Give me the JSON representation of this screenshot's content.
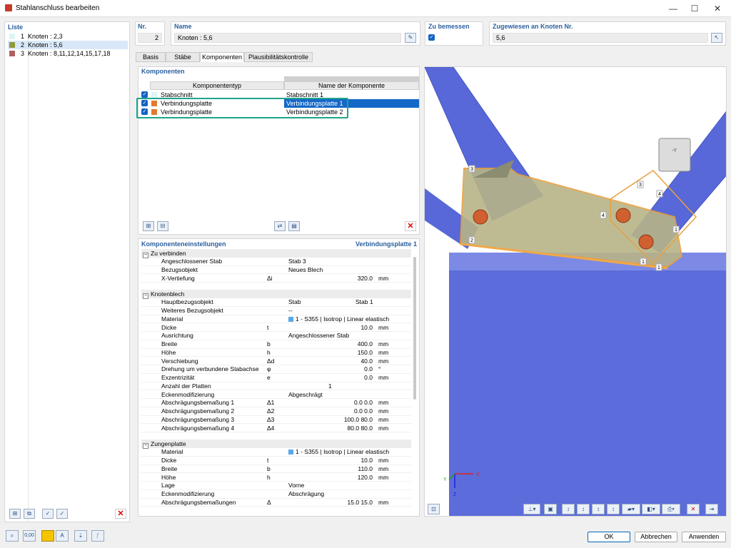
{
  "window": {
    "title": "Stahlanschluss bearbeiten",
    "minimize": "—",
    "maximize": "☐",
    "close": "✕"
  },
  "list": {
    "header": "Liste",
    "items": [
      {
        "num": "1",
        "label": "Knoten : 2,3",
        "color": "#dff4f6"
      },
      {
        "num": "2",
        "label": "Knoten : 5,6",
        "color": "#8f9a3a"
      },
      {
        "num": "3",
        "label": "Knoten : 8,11,12,14,15,17,18",
        "color": "#b06060"
      }
    ]
  },
  "header": {
    "nr_label": "Nr.",
    "nr_value": "2",
    "name_label": "Name",
    "name_value": "Knoten : 5,6",
    "zu_bemessen_label": "Zu bemessen",
    "zugewiesen_label": "Zugewiesen an Knoten Nr.",
    "zugewiesen_value": "5,6"
  },
  "tabs": [
    "Basis",
    "Stäbe",
    "Komponenten",
    "Plausibilitätskontrolle"
  ],
  "komponenten": {
    "title": "Komponenten",
    "col_type": "Komponententyp",
    "col_name": "Name der Komponente",
    "rows": [
      {
        "type": "Stabschnitt",
        "name": "Stabschnitt 1",
        "color": "#dff4f6"
      },
      {
        "type": "Verbindungsplatte",
        "name": "Verbindungsplatte 1",
        "color": "#e07a30"
      },
      {
        "type": "Verbindungsplatte",
        "name": "Verbindungsplatte 2",
        "color": "#e07a30"
      }
    ]
  },
  "settings": {
    "title": "Komponenteneinstellungen",
    "component": "Verbindungsplatte 1",
    "groups": [
      {
        "label": "Zu verbinden",
        "rows": [
          {
            "name": "Angeschlossener Stab",
            "sym": "",
            "val": "Stab 3",
            "num": "",
            "unit": ""
          },
          {
            "name": "Bezugsobjekt",
            "sym": "",
            "val": "Neues Blech",
            "num": "",
            "unit": ""
          },
          {
            "name": "X-Vertiefung",
            "sym": "Δi",
            "val": "",
            "num": "320.0",
            "unit": "mm"
          }
        ]
      },
      {
        "label": "Knotenblech",
        "rows": [
          {
            "name": "Hauptbezugsobjekt",
            "sym": "",
            "val": "Stab",
            "v2": "Stab 1",
            "num": "",
            "unit": ""
          },
          {
            "name": "Weiteres Bezugsobjekt",
            "sym": "",
            "val": "--",
            "num": "",
            "unit": ""
          },
          {
            "name": "Material",
            "sym": "",
            "val": "1 - S355 | Isotrop | Linear elastisch",
            "mat": true,
            "num": "",
            "unit": ""
          },
          {
            "name": "Dicke",
            "sym": "t",
            "val": "",
            "num": "10.0",
            "unit": "mm"
          },
          {
            "name": "Ausrichtung",
            "sym": "",
            "val": "Angeschlossener Stab",
            "num": "",
            "unit": ""
          },
          {
            "name": "Breite",
            "sym": "b",
            "val": "",
            "num": "400.0",
            "unit": "mm"
          },
          {
            "name": "Höhe",
            "sym": "h",
            "val": "",
            "num": "150.0",
            "unit": "mm"
          },
          {
            "name": "Verschiebung",
            "sym": "Δd",
            "val": "",
            "num": "40.0",
            "unit": "mm"
          },
          {
            "name": "Drehung um verbundene Stabachse",
            "sym": "φ",
            "val": "",
            "num": "0.0",
            "unit": "°"
          },
          {
            "name": "Exzentrizität",
            "sym": "e",
            "val": "",
            "num": "0.0",
            "unit": "mm"
          },
          {
            "name": "Anzahl der Platten",
            "sym": "",
            "val": "",
            "num": "1",
            "unit": "",
            "center": true
          },
          {
            "name": "Eckenmodifizierung",
            "sym": "",
            "val": "Abgeschrägt",
            "num": "",
            "unit": ""
          },
          {
            "name": "Abschrägungsbemaßung 1",
            "sym": "Δ1",
            "val": "",
            "num": "0.0 0.0",
            "unit": "mm"
          },
          {
            "name": "Abschrägungsbemaßung 2",
            "sym": "Δ2",
            "val": "",
            "num": "0.0 0.0",
            "unit": "mm"
          },
          {
            "name": "Abschrägungsbemaßung 3",
            "sym": "Δ3",
            "val": "",
            "num": "100.0 80.0",
            "unit": "mm"
          },
          {
            "name": "Abschrägungsbemaßung 4",
            "sym": "Δ4",
            "val": "",
            "num": "80.0 80.0",
            "unit": "mm"
          }
        ]
      },
      {
        "label": "Zungenplatte",
        "rows": [
          {
            "name": "Material",
            "sym": "",
            "val": "1 - S355 | Isotrop | Linear elastisch",
            "mat": true,
            "num": "",
            "unit": ""
          },
          {
            "name": "Dicke",
            "sym": "t",
            "val": "",
            "num": "10.0",
            "unit": "mm"
          },
          {
            "name": "Breite",
            "sym": "b",
            "val": "",
            "num": "110.0",
            "unit": "mm"
          },
          {
            "name": "Höhe",
            "sym": "h",
            "val": "",
            "num": "120.0",
            "unit": "mm"
          },
          {
            "name": "Lage",
            "sym": "",
            "val": "Vorne",
            "num": "",
            "unit": ""
          },
          {
            "name": "Eckenmodifizierung",
            "sym": "",
            "val": "Abschrägung",
            "num": "",
            "unit": ""
          },
          {
            "name": "Abschrägungsbemaßungen",
            "sym": "Δ",
            "val": "",
            "num": "15.0 15.0",
            "unit": "mm"
          }
        ]
      }
    ]
  },
  "view3d": {
    "labels": [
      "1",
      "2",
      "3",
      "4",
      "4",
      "3",
      "1",
      "1"
    ],
    "axis_x": "X",
    "axis_y": "Y",
    "axis_z": "Z",
    "cube_label": "-Y"
  },
  "footer": {
    "ok": "OK",
    "cancel": "Abbrechen",
    "apply": "Anwenden",
    "zero_icon": "0,00"
  }
}
